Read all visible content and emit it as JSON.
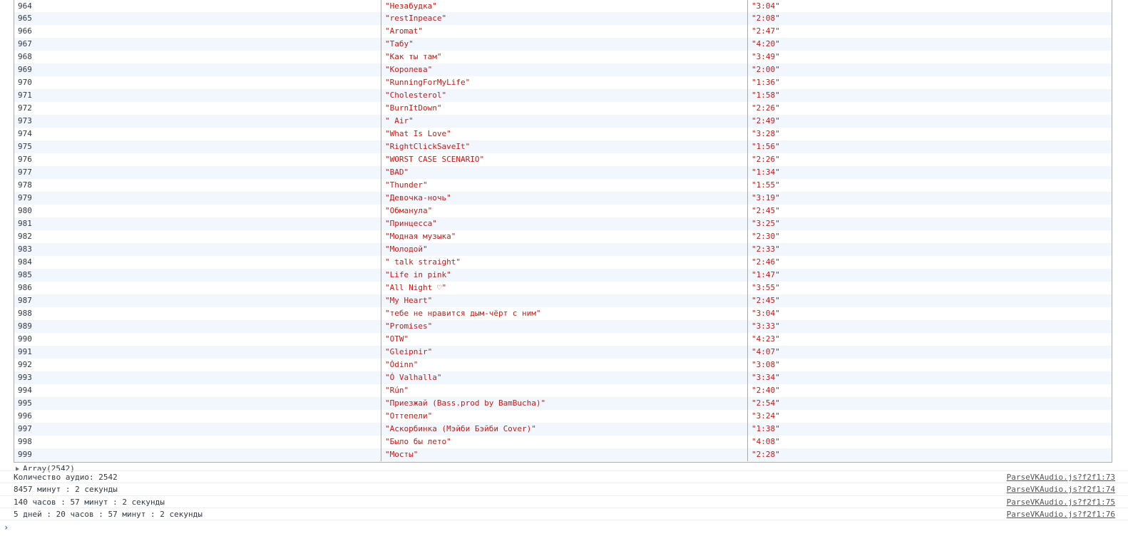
{
  "table": {
    "rows": [
      {
        "idx": "964",
        "title": "\"Незабудка\"",
        "dur": "\"3:04\""
      },
      {
        "idx": "965",
        "title": "\"restInpeace\"",
        "dur": "\"2:08\""
      },
      {
        "idx": "966",
        "title": "\"Aromat\"",
        "dur": "\"2:47\""
      },
      {
        "idx": "967",
        "title": "\"Табу\"",
        "dur": "\"4:20\""
      },
      {
        "idx": "968",
        "title": "\"Как ты там\"",
        "dur": "\"3:49\""
      },
      {
        "idx": "969",
        "title": "\"Королева\"",
        "dur": "\"2:00\""
      },
      {
        "idx": "970",
        "title": "\"RunningForMyLife\"",
        "dur": "\"1:36\""
      },
      {
        "idx": "971",
        "title": "\"Cholesterol\"",
        "dur": "\"1:58\""
      },
      {
        "idx": "972",
        "title": "\"BurnItDown\"",
        "dur": "\"2:26\""
      },
      {
        "idx": "973",
        "title": "\" Air\"",
        "dur": "\"2:49\""
      },
      {
        "idx": "974",
        "title": "\"What Is Love\"",
        "dur": "\"3:28\""
      },
      {
        "idx": "975",
        "title": "\"RightClickSaveIt\"",
        "dur": "\"1:56\""
      },
      {
        "idx": "976",
        "title": "\"WORST CASE SCENARIO\"",
        "dur": "\"2:26\""
      },
      {
        "idx": "977",
        "title": "\"BAD\"",
        "dur": "\"1:34\""
      },
      {
        "idx": "978",
        "title": "\"Thunder\"",
        "dur": "\"1:55\""
      },
      {
        "idx": "979",
        "title": "\"Девочка-ночь\"",
        "dur": "\"3:19\""
      },
      {
        "idx": "980",
        "title": "\"Обманула\"",
        "dur": "\"2:45\""
      },
      {
        "idx": "981",
        "title": "\"Принцесса\"",
        "dur": "\"3:25\""
      },
      {
        "idx": "982",
        "title": "\"Модная музыка\"",
        "dur": "\"2:30\""
      },
      {
        "idx": "983",
        "title": "\"Молодой\"",
        "dur": "\"2:33\""
      },
      {
        "idx": "984",
        "title": "\" talk straight\"",
        "dur": "\"2:46\""
      },
      {
        "idx": "985",
        "title": "\"Life in pink\"",
        "dur": "\"1:47\""
      },
      {
        "idx": "986",
        "title": "\"All Night ♡\"",
        "dur": "\"3:55\""
      },
      {
        "idx": "987",
        "title": "\"My Heart\"",
        "dur": "\"2:45\""
      },
      {
        "idx": "988",
        "title": "\"тебе не нравится дым-чёрт с ним\"",
        "dur": "\"3:04\""
      },
      {
        "idx": "989",
        "title": "\"Promises\"",
        "dur": "\"3:33\""
      },
      {
        "idx": "990",
        "title": "\"OTW\"",
        "dur": "\"4:23\""
      },
      {
        "idx": "991",
        "title": "\"Gleipnir\"",
        "dur": "\"4:07\""
      },
      {
        "idx": "992",
        "title": "\"Ódinn\"",
        "dur": "\"3:08\""
      },
      {
        "idx": "993",
        "title": "\"Ó Valhalla\"",
        "dur": "\"3:34\""
      },
      {
        "idx": "994",
        "title": "\"Rún\"",
        "dur": "\"2:40\""
      },
      {
        "idx": "995",
        "title": "\"Приезжай (Bass.prod by BamBucha)\"",
        "dur": "\"2:54\""
      },
      {
        "idx": "996",
        "title": "\"Оттепели\"",
        "dur": "\"3:24\""
      },
      {
        "idx": "997",
        "title": "\"Аскорбинка (Мэйби Бэйби Cover)\"",
        "dur": "\"1:38\""
      },
      {
        "idx": "998",
        "title": "\"Было бы лето\"",
        "dur": "\"4:08\""
      },
      {
        "idx": "999",
        "title": "\"Мосты\"",
        "dur": "\"2:28\""
      }
    ]
  },
  "array_summary": "Array(2542)",
  "logs": [
    {
      "msg": "Количество аудио: 2542",
      "src": "ParseVKAudio.js?f2f1:73"
    },
    {
      "msg": "8457 минут : 2 секунды",
      "src": "ParseVKAudio.js?f2f1:74"
    },
    {
      "msg": "140 часов : 57 минут : 2 секунды",
      "src": "ParseVKAudio.js?f2f1:75"
    },
    {
      "msg": "5 дней : 20 часов : 57 минут : 2 секунды",
      "src": "ParseVKAudio.js?f2f1:76"
    }
  ],
  "prompt_symbol": "›",
  "colors": {
    "string": "#c41a16",
    "row_alt": "#f2f7fd",
    "prompt": "#1a73e8"
  }
}
